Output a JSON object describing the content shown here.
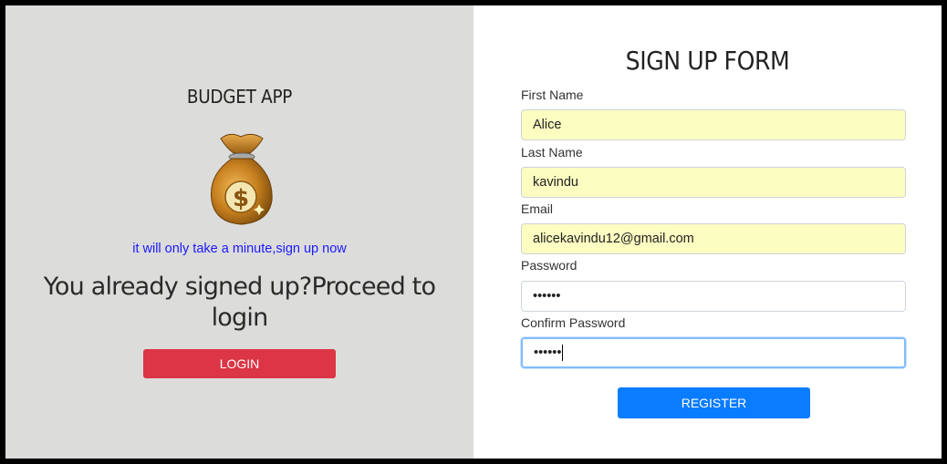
{
  "left_panel": {
    "app_title": "BUDGET APP",
    "tagline": "it will only take a minute,sign up now",
    "proceed_text": "You already signed up?Proceed to login",
    "login_button": "LOGIN",
    "icon": "money-bag-icon"
  },
  "form": {
    "title": "SIGN UP FORM",
    "fields": [
      {
        "label": "First Name",
        "value": "Alice"
      },
      {
        "label": "Last Name",
        "value": "kavindu"
      },
      {
        "label": "Email",
        "value": "alicekavindu12@gmail.com"
      },
      {
        "label": "Password",
        "value": "••••••"
      },
      {
        "label": "Confirm Password",
        "value": "••••••"
      }
    ],
    "register_button": "REGISTER"
  },
  "colors": {
    "left_bg": "#dcdcdb",
    "login_button": "#dc3545",
    "register_button": "#0a7cff",
    "autofill_bg": "#fbfdc1",
    "tagline": "#1a1aff"
  }
}
